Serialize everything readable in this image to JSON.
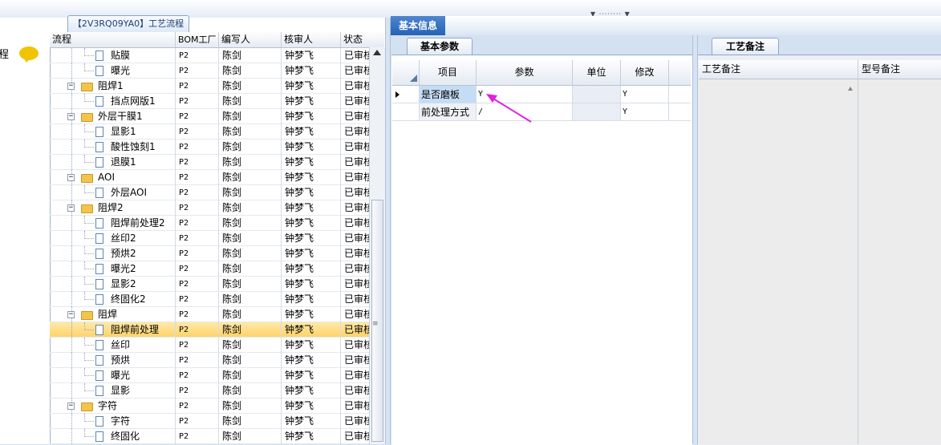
{
  "panel_tab": "【2V3RQ09YA0】工艺流程",
  "left_strip_label": "程",
  "tree": {
    "headers": [
      "流程",
      "BOM工厂",
      "编写人",
      "核审人",
      "状态"
    ],
    "rows": [
      {
        "name": "贴膜",
        "kind": "doc",
        "level": 2,
        "bom": "P2",
        "writer": "陈剑",
        "reviewer": "钟梦飞",
        "status": "已审核"
      },
      {
        "name": "曝光",
        "kind": "doc",
        "level": 2,
        "bom": "P2",
        "writer": "陈剑",
        "reviewer": "钟梦飞",
        "status": "已审核"
      },
      {
        "name": "阻焊1",
        "kind": "folder",
        "level": 1,
        "bom": "P2",
        "writer": "陈剑",
        "reviewer": "钟梦飞",
        "status": "已审核"
      },
      {
        "name": "挡点网版1",
        "kind": "doc",
        "level": 2,
        "bom": "P2",
        "writer": "陈剑",
        "reviewer": "钟梦飞",
        "status": "已审核"
      },
      {
        "name": "外层干膜1",
        "kind": "folder",
        "level": 1,
        "bom": "P2",
        "writer": "陈剑",
        "reviewer": "钟梦飞",
        "status": "已审核"
      },
      {
        "name": "显影1",
        "kind": "doc",
        "level": 2,
        "bom": "P2",
        "writer": "陈剑",
        "reviewer": "钟梦飞",
        "status": "已审核"
      },
      {
        "name": "酸性蚀刻1",
        "kind": "doc",
        "level": 2,
        "bom": "P2",
        "writer": "陈剑",
        "reviewer": "钟梦飞",
        "status": "已审核"
      },
      {
        "name": "退膜1",
        "kind": "doc",
        "level": 2,
        "bom": "P2",
        "writer": "陈剑",
        "reviewer": "钟梦飞",
        "status": "已审核"
      },
      {
        "name": "AOI",
        "kind": "folder",
        "level": 1,
        "bom": "P2",
        "writer": "陈剑",
        "reviewer": "钟梦飞",
        "status": "已审核"
      },
      {
        "name": "外层AOI",
        "kind": "doc",
        "level": 2,
        "bom": "P2",
        "writer": "陈剑",
        "reviewer": "钟梦飞",
        "status": "已审核"
      },
      {
        "name": "阻焊2",
        "kind": "folder",
        "level": 1,
        "bom": "P2",
        "writer": "陈剑",
        "reviewer": "钟梦飞",
        "status": "已审核"
      },
      {
        "name": "阻焊前处理2",
        "kind": "doc",
        "level": 2,
        "bom": "P2",
        "writer": "陈剑",
        "reviewer": "钟梦飞",
        "status": "已审核"
      },
      {
        "name": "丝印2",
        "kind": "doc",
        "level": 2,
        "bom": "P2",
        "writer": "陈剑",
        "reviewer": "钟梦飞",
        "status": "已审核"
      },
      {
        "name": "预烘2",
        "kind": "doc",
        "level": 2,
        "bom": "P2",
        "writer": "陈剑",
        "reviewer": "钟梦飞",
        "status": "已审核"
      },
      {
        "name": "曝光2",
        "kind": "doc",
        "level": 2,
        "bom": "P2",
        "writer": "陈剑",
        "reviewer": "钟梦飞",
        "status": "已审核"
      },
      {
        "name": "显影2",
        "kind": "doc",
        "level": 2,
        "bom": "P2",
        "writer": "陈剑",
        "reviewer": "钟梦飞",
        "status": "已审核"
      },
      {
        "name": "终固化2",
        "kind": "doc",
        "level": 2,
        "bom": "P2",
        "writer": "陈剑",
        "reviewer": "钟梦飞",
        "status": "已审核"
      },
      {
        "name": "阻焊",
        "kind": "folder",
        "level": 1,
        "bom": "P2",
        "writer": "陈剑",
        "reviewer": "钟梦飞",
        "status": "已审核"
      },
      {
        "name": "阻焊前处理",
        "kind": "doc",
        "level": 2,
        "bom": "P2",
        "writer": "陈剑",
        "reviewer": "钟梦飞",
        "status": "已审核",
        "selected": true
      },
      {
        "name": "丝印",
        "kind": "doc",
        "level": 2,
        "bom": "P2",
        "writer": "陈剑",
        "reviewer": "钟梦飞",
        "status": "已审核"
      },
      {
        "name": "预烘",
        "kind": "doc",
        "level": 2,
        "bom": "P2",
        "writer": "陈剑",
        "reviewer": "钟梦飞",
        "status": "已审核"
      },
      {
        "name": "曝光",
        "kind": "doc",
        "level": 2,
        "bom": "P2",
        "writer": "陈剑",
        "reviewer": "钟梦飞",
        "status": "已审核"
      },
      {
        "name": "显影",
        "kind": "doc",
        "level": 2,
        "bom": "P2",
        "writer": "陈剑",
        "reviewer": "钟梦飞",
        "status": "已审核"
      },
      {
        "name": "字符",
        "kind": "folder",
        "level": 1,
        "bom": "P2",
        "writer": "陈剑",
        "reviewer": "钟梦飞",
        "status": "已审核"
      },
      {
        "name": "字符",
        "kind": "doc",
        "level": 2,
        "bom": "P2",
        "writer": "陈剑",
        "reviewer": "钟梦飞",
        "status": "已审核"
      },
      {
        "name": "终固化",
        "kind": "doc",
        "level": 2,
        "bom": "P2",
        "writer": "陈剑",
        "reviewer": "钟梦飞",
        "status": "已审核"
      }
    ]
  },
  "middle": {
    "title": "基本信息",
    "tab": "基本参数",
    "grid_headers": [
      "项目",
      "参数",
      "单位",
      "修改"
    ],
    "grid_rows": [
      {
        "item": "是否磨板",
        "param": "Y",
        "unit": "",
        "modify": "Y",
        "current": true
      },
      {
        "item": "前处理方式",
        "param": "/",
        "unit": "",
        "modify": "Y"
      }
    ]
  },
  "right": {
    "tab": "工艺备注",
    "headers": [
      "工艺备注",
      "型号备注"
    ]
  },
  "colors": {
    "title_bg": "#2563b5",
    "selection": "#ffd36b",
    "annotation_arrow": "#e021e0"
  }
}
